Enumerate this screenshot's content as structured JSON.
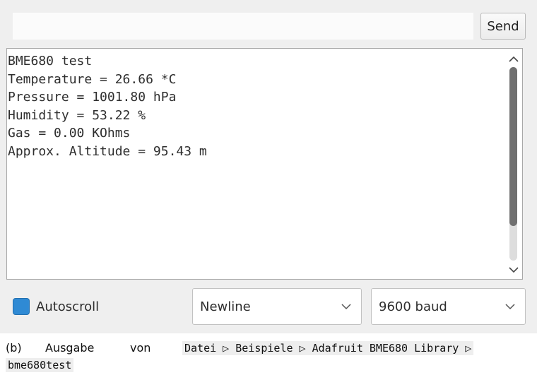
{
  "send_bar": {
    "input_value": "",
    "send_label": "Send"
  },
  "output": {
    "lines": [
      "BME680 test",
      "Temperature = 26.66 *C",
      "Pressure = 1001.80 hPa",
      "Humidity = 53.22 %",
      "Gas = 0.00 KOhms",
      "Approx. Altitude = 95.43 m"
    ],
    "scroll_thumb_fraction": 0.82
  },
  "footer": {
    "autoscroll_label": "Autoscroll",
    "autoscroll_checked": true,
    "line_ending": "Newline",
    "baud_rate": "9600 baud"
  },
  "caption": {
    "label": "(b)",
    "word1": "Ausgabe",
    "word2": "von",
    "path": "Datei ▷ Beispiele ▷ Adafruit BME680 Library ▷",
    "path_cont": "bme680test"
  },
  "colors": {
    "accent": "#2f8ad4",
    "window_bg": "#efefef",
    "scroll_thumb": "#6f6f6f"
  }
}
